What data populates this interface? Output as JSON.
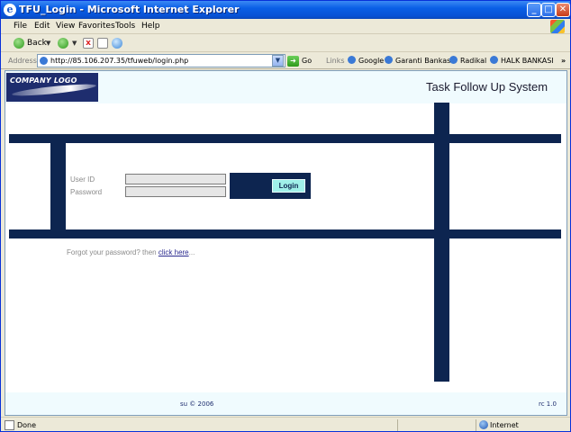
{
  "window": {
    "title": "TFU_Login - Microsoft Internet Explorer"
  },
  "menu": [
    "File",
    "Edit",
    "View",
    "Favorites",
    "Tools",
    "Help"
  ],
  "toolbar": {
    "back_label": "Back"
  },
  "address": {
    "label": "Address",
    "url": "http://85.106.207.35/tfuweb/login.php",
    "go_label": "Go"
  },
  "links": {
    "label": "Links",
    "items": [
      "Google",
      "Garanti Bankasi",
      "Radikal",
      "HALK BANKASI"
    ]
  },
  "page": {
    "logo_text": "COMPANY LOGO",
    "app_title": "Task Follow Up System",
    "user_label": "User ID",
    "password_label": "Password",
    "user_value": "",
    "password_value": "",
    "login_button": "Login",
    "forgot_prefix": "Forgot your password? then ",
    "forgot_link": "click here",
    "forgot_suffix": "...",
    "footer_copy": "su © 2006",
    "footer_version": "rc 1.0",
    "accent_color": "#0D2550",
    "button_color": "#9FF0E9"
  },
  "status": {
    "text": "Done",
    "zone": "Internet"
  }
}
